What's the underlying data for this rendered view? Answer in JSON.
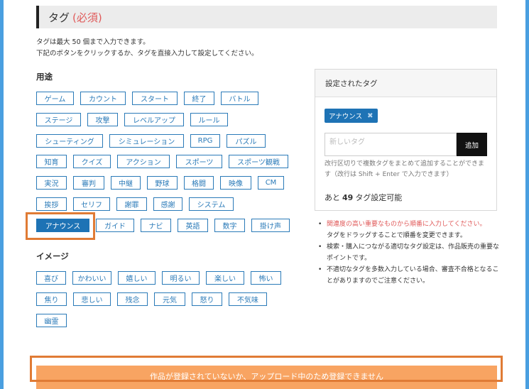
{
  "section": {
    "title": "タグ",
    "required": "(必須)"
  },
  "intro": {
    "line1": "タグは最大 50 個まで入力できます。",
    "line2": "下記のボタンをクリックするか、タグを直接入力して設定してください。"
  },
  "groups": {
    "usage": {
      "label": "用途",
      "rows": [
        [
          "ゲーム",
          "カウント",
          "スタート",
          "終了",
          "バトル"
        ],
        [
          "ステージ",
          "攻撃",
          "レベルアップ",
          "ルール"
        ],
        [
          "シューティング",
          "シミュレーション",
          "RPG",
          "パズル"
        ],
        [
          "知育",
          "クイズ",
          "アクション",
          "スポーツ",
          "スポーツ観戦"
        ],
        [
          "実況",
          "審判",
          "中継",
          "野球",
          "格闘",
          "映像",
          "CM"
        ],
        [
          "挨拶",
          "セリフ",
          "謝罪",
          "感謝",
          "システム"
        ],
        [
          "アナウンス",
          "ガイド",
          "ナビ",
          "英語",
          "数字",
          "掛け声"
        ]
      ]
    },
    "image": {
      "label": "イメージ",
      "rows": [
        [
          "喜び",
          "かわいい",
          "嬉しい",
          "明るい",
          "楽しい",
          "怖い"
        ],
        [
          "焦り",
          "悲しい",
          "残念",
          "元気",
          "怒り",
          "不気味"
        ],
        [
          "幽霊"
        ]
      ]
    }
  },
  "selected_tag_button": "アナウンス",
  "panel": {
    "title": "設定されたタグ",
    "chips": [
      {
        "label": "アナウンス",
        "remove_icon": "✖"
      }
    ],
    "input_placeholder": "新しいタグ",
    "add_label": "追加",
    "hint": "改行区切りで複数タグをまとめて追加することができます（改行は Shift + Enter で入力できます）",
    "remain_prefix": "あと",
    "remain_count": "49",
    "remain_suffix": "タグ設定可能"
  },
  "notes": [
    {
      "text": "関連度の高い重要なものから順番に入力してください。",
      "continuation": "タグをドラッグすることで順番を変更できます。"
    },
    {
      "text": "検索・購入につながる適切なタグ設定は、作品販売の重要なポイントです。"
    },
    {
      "text": "不適切なタグを多数入力している場合、審査不合格となることがありますのでご注意ください。"
    }
  ],
  "submit": {
    "label": "作品が登録されていないか、アップロード中のため登録できません"
  },
  "colors": {
    "accent": "#1e73b5",
    "required": "#e05a5a",
    "highlight": "#e07b35",
    "submit": "#f8a462",
    "frame": "#4a9fe0"
  }
}
